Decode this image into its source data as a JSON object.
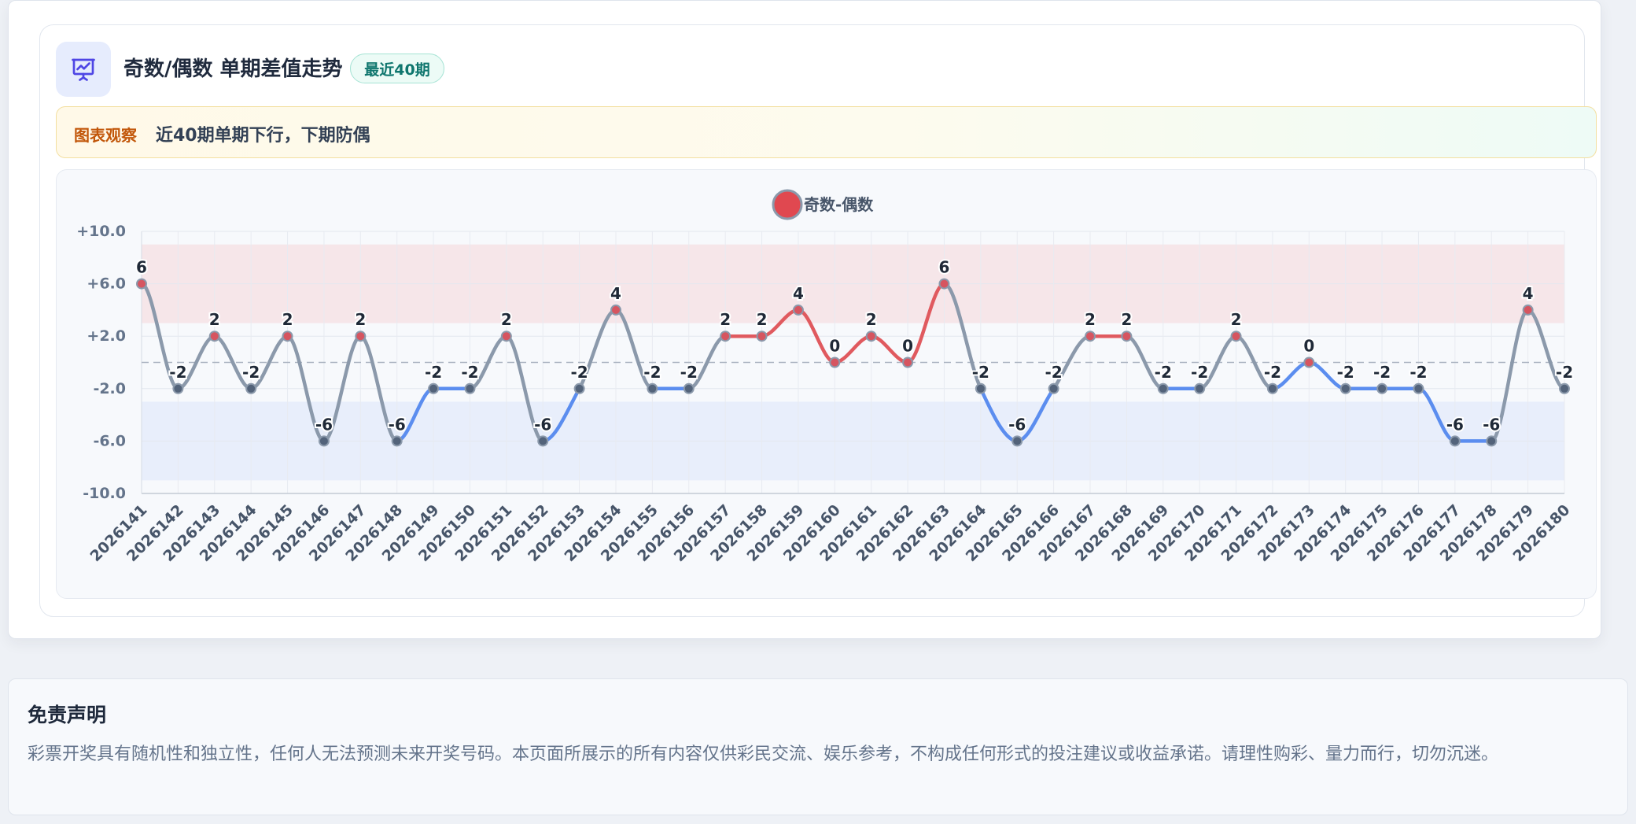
{
  "header": {
    "title": "奇数/偶数 单期差值走势",
    "badge": "最近40期",
    "icon": "presentation-chart-icon"
  },
  "observation": {
    "label": "图表观察",
    "text": "近40期单期下行，下期防偶"
  },
  "disclaimer": {
    "title": "免责声明",
    "text": "彩票开奖具有随机性和独立性，任何人无法预测未来开奖号码。本页面所展示的所有内容仅供彩民交流、娱乐参考，不构成任何形式的投注建议或收益承诺。请理性购彩、量力而行，切勿沉迷。"
  },
  "colors": {
    "positive": "#e05a5f",
    "negative": "#5b8def",
    "neutral": "#8b99ab",
    "accent": "#4f46e5"
  },
  "chart_data": {
    "type": "line",
    "legend": "奇数-偶数",
    "legend_position": "top-center",
    "ylim": [
      -10,
      10
    ],
    "yticks": [
      10,
      6,
      2,
      -2,
      -6,
      -10
    ],
    "ytick_labels": [
      "+10.0",
      "+6.0",
      "+2.0",
      "-2.0",
      "-6.0",
      "-10.0"
    ],
    "bands": [
      {
        "from": 3,
        "to": 9,
        "color": "#f6e6e9"
      },
      {
        "from": -9,
        "to": -3,
        "color": "#e8eefb"
      }
    ],
    "reference_line": 0,
    "grid": true,
    "x": [
      "2026141",
      "2026142",
      "2026143",
      "2026144",
      "2026145",
      "2026146",
      "2026147",
      "2026148",
      "2026149",
      "2026150",
      "2026151",
      "2026152",
      "2026153",
      "2026154",
      "2026155",
      "2026156",
      "2026157",
      "2026158",
      "2026159",
      "2026160",
      "2026161",
      "2026162",
      "2026163",
      "2026164",
      "2026165",
      "2026166",
      "2026167",
      "2026168",
      "2026169",
      "2026170",
      "2026171",
      "2026172",
      "2026173",
      "2026174",
      "2026175",
      "2026176",
      "2026177",
      "2026178",
      "2026179",
      "2026180"
    ],
    "values": [
      6,
      -2,
      2,
      -2,
      2,
      -6,
      2,
      -6,
      -2,
      -2,
      2,
      -6,
      -2,
      4,
      -2,
      -2,
      2,
      2,
      4,
      0,
      2,
      0,
      6,
      -2,
      -6,
      -2,
      2,
      2,
      -2,
      -2,
      2,
      -2,
      0,
      -2,
      -2,
      -2,
      -6,
      -6,
      4,
      -2
    ],
    "data_labels": [
      "6",
      "-2",
      "2",
      "-2",
      "2",
      "-6",
      "2",
      "-6",
      "-2",
      "-2",
      "2",
      "-6",
      "-2",
      "4",
      "-2",
      "-2",
      "2",
      "2",
      "4",
      "0",
      "2",
      "0",
      "6",
      "-2",
      "-6",
      "-2",
      "2",
      "2",
      "-2",
      "-2",
      "2",
      "-2",
      "0",
      "-2",
      "-2",
      "-2",
      "-6",
      "-6",
      "4",
      "-2"
    ]
  }
}
